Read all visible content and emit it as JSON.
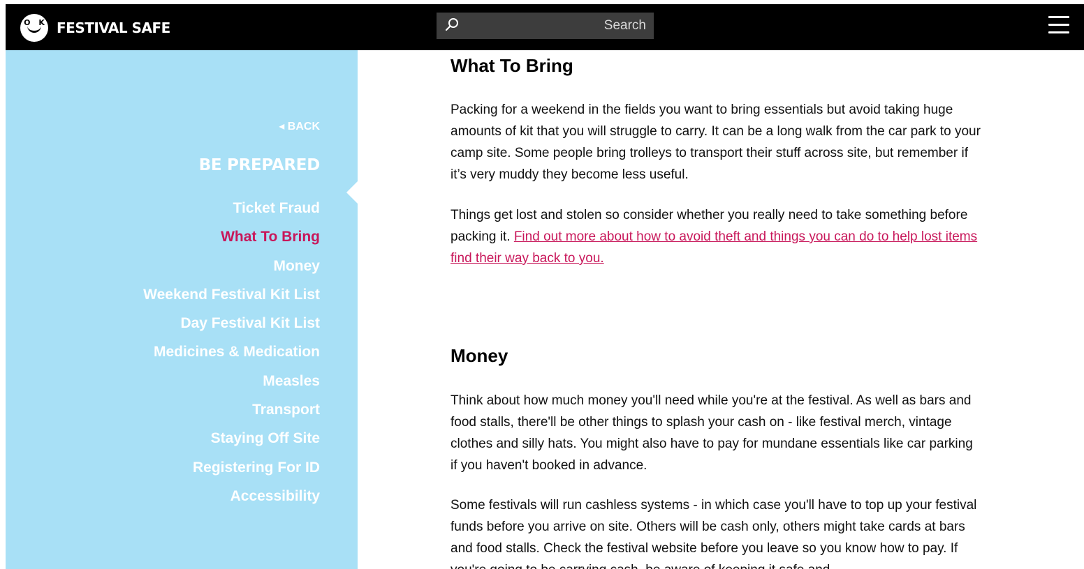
{
  "header": {
    "brand_badge": "O K",
    "brand": "FESTIVAL SAFE",
    "search_placeholder": "Search",
    "icons": {
      "search": "magnifier-icon",
      "menu": "hamburger-menu-icon"
    }
  },
  "sidebar": {
    "back_label": "◂ BACK",
    "section_title": "BE PREPARED",
    "items": [
      {
        "label": "Ticket Fraud",
        "active": false
      },
      {
        "label": "What To Bring",
        "active": true
      },
      {
        "label": "Money",
        "active": false
      },
      {
        "label": "Weekend Festival Kit List",
        "active": false
      },
      {
        "label": "Day Festival Kit List",
        "active": false
      },
      {
        "label": "Medicines & Medication",
        "active": false
      },
      {
        "label": "Measles",
        "active": false
      },
      {
        "label": "Transport",
        "active": false
      },
      {
        "label": "Staying Off Site",
        "active": false
      },
      {
        "label": "Registering For ID",
        "active": false
      },
      {
        "label": "Accessibility",
        "active": false
      }
    ]
  },
  "main": {
    "what_to_bring": {
      "heading": "What To Bring",
      "p1": "Packing for a weekend in the fields you want to bring essentials but avoid taking huge amounts of kit that you will struggle to carry. It can be a long walk from the car park to your camp site. Some people bring trolleys to transport their stuff across site, but remember if it’s very muddy they become less useful.",
      "p2_text": "Things get lost and stolen so consider whether you really need to take something before packing it. ",
      "p2_link": "Find out more about how to avoid theft and things you can do to help lost items find their way back to you."
    },
    "money": {
      "heading": "Money",
      "p1": "Think about how much money you'll need while you're at the festival. As well as bars and food stalls, there'll be other things to splash your cash on - like festival merch, vintage clothes and silly hats. You might also have to pay for mundane essentials like car parking if you haven't booked in advance.",
      "p2": "Some festivals will run cashless systems - in which case you'll have to top up your festival funds before you arrive on site. Others will be cash only, others might take cards at bars and food stalls. Check the festival website before you leave so you know how to pay. If you're going to be carrying cash, be aware of keeping it safe and"
    }
  },
  "colors": {
    "header_bg": "#000000",
    "sidebar_bg": "#a8e0f6",
    "accent": "#c8175a",
    "search_bg": "#3d3d3d"
  }
}
